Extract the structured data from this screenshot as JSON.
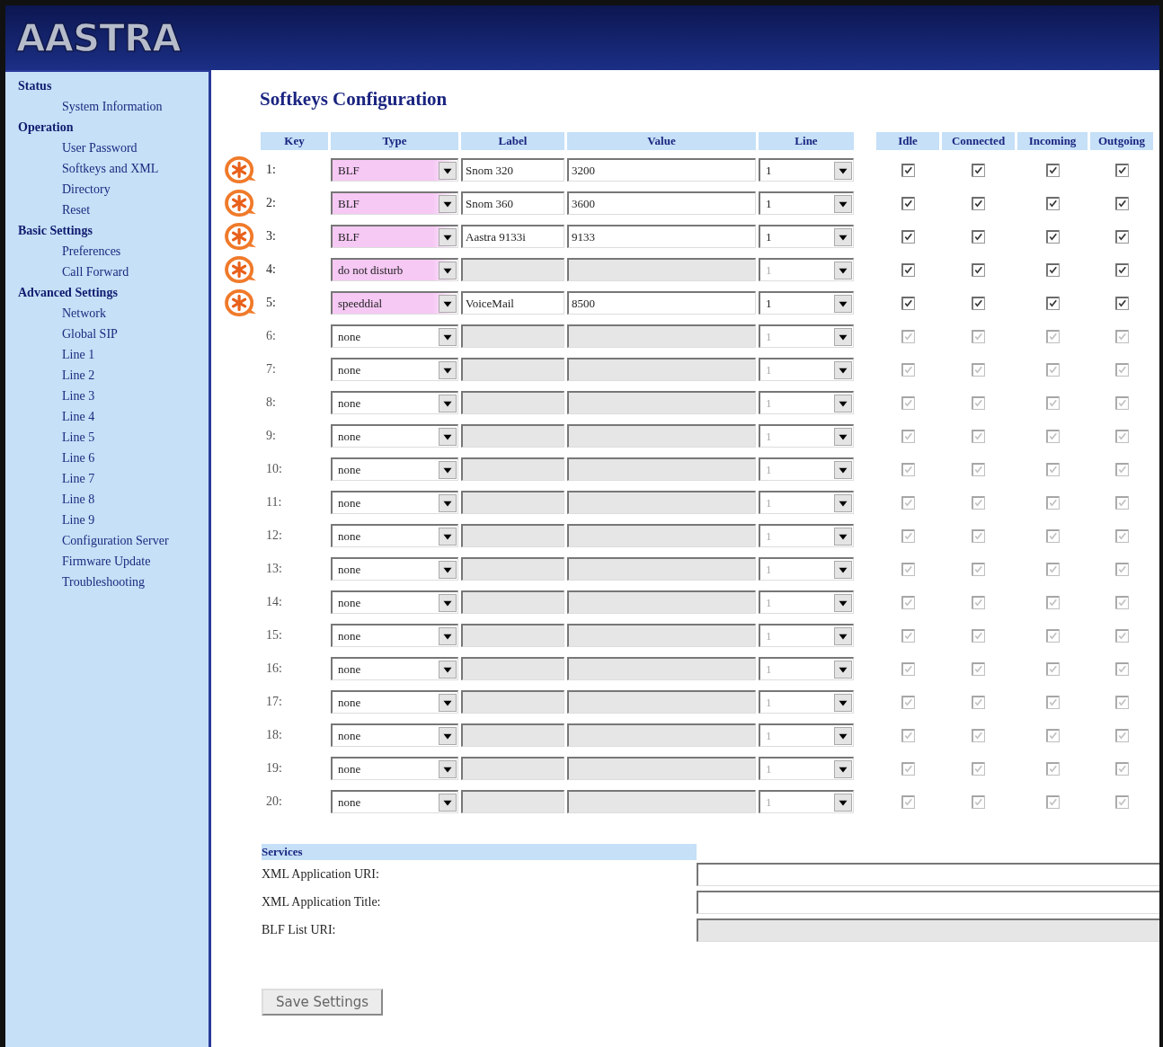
{
  "header": {
    "logo": "AASTRA"
  },
  "sidebar": {
    "groups": [
      {
        "title": "Status",
        "items": [
          "System Information"
        ]
      },
      {
        "title": "Operation",
        "items": [
          "User Password",
          "Softkeys and XML",
          "Directory",
          "Reset"
        ]
      },
      {
        "title": "Basic Settings",
        "items": [
          "Preferences",
          "Call Forward"
        ]
      },
      {
        "title": "Advanced Settings",
        "items": [
          "Network",
          "Global SIP",
          "Line 1",
          "Line 2",
          "Line 3",
          "Line 4",
          "Line 5",
          "Line 6",
          "Line 7",
          "Line 8",
          "Line 9",
          "Configuration Server",
          "Firmware Update",
          "Troubleshooting"
        ]
      }
    ]
  },
  "page_title": "Softkeys Configuration",
  "table": {
    "columns": [
      "Key",
      "Type",
      "Label",
      "Value",
      "Line",
      "Idle",
      "Connected",
      "Incoming",
      "Outgoing"
    ],
    "rows": [
      {
        "key": "1:",
        "type": "BLF",
        "label": "Snom 320",
        "value": "3200",
        "line": "1",
        "highlighted": true,
        "disabled": false,
        "line_disabled": false,
        "idle": true,
        "connected": true,
        "incoming": true,
        "outgoing": true
      },
      {
        "key": "2:",
        "type": "BLF",
        "label": "Snom 360",
        "value": "3600",
        "line": "1",
        "highlighted": true,
        "disabled": false,
        "line_disabled": false,
        "idle": true,
        "connected": true,
        "incoming": true,
        "outgoing": true
      },
      {
        "key": "3:",
        "type": "BLF",
        "label": "Aastra 9133i",
        "value": "9133",
        "line": "1",
        "highlighted": true,
        "disabled": false,
        "line_disabled": false,
        "idle": true,
        "connected": true,
        "incoming": true,
        "outgoing": true
      },
      {
        "key": "4:",
        "type": "do not disturb",
        "label": "",
        "value": "",
        "line": "1",
        "highlighted": true,
        "disabled": true,
        "line_disabled": true,
        "idle": true,
        "connected": true,
        "incoming": true,
        "outgoing": true
      },
      {
        "key": "5:",
        "type": "speeddial",
        "label": "VoiceMail",
        "value": "8500",
        "line": "1",
        "highlighted": true,
        "disabled": false,
        "line_disabled": false,
        "idle": true,
        "connected": true,
        "incoming": true,
        "outgoing": true
      },
      {
        "key": "6:",
        "type": "none",
        "label": "",
        "value": "",
        "line": "1",
        "highlighted": false,
        "disabled": true,
        "line_disabled": true,
        "idle": true,
        "connected": true,
        "incoming": true,
        "outgoing": true
      },
      {
        "key": "7:",
        "type": "none",
        "label": "",
        "value": "",
        "line": "1",
        "highlighted": false,
        "disabled": true,
        "line_disabled": true,
        "idle": true,
        "connected": true,
        "incoming": true,
        "outgoing": true
      },
      {
        "key": "8:",
        "type": "none",
        "label": "",
        "value": "",
        "line": "1",
        "highlighted": false,
        "disabled": true,
        "line_disabled": true,
        "idle": true,
        "connected": true,
        "incoming": true,
        "outgoing": true
      },
      {
        "key": "9:",
        "type": "none",
        "label": "",
        "value": "",
        "line": "1",
        "highlighted": false,
        "disabled": true,
        "line_disabled": true,
        "idle": true,
        "connected": true,
        "incoming": true,
        "outgoing": true
      },
      {
        "key": "10:",
        "type": "none",
        "label": "",
        "value": "",
        "line": "1",
        "highlighted": false,
        "disabled": true,
        "line_disabled": true,
        "idle": true,
        "connected": true,
        "incoming": true,
        "outgoing": true
      },
      {
        "key": "11:",
        "type": "none",
        "label": "",
        "value": "",
        "line": "1",
        "highlighted": false,
        "disabled": true,
        "line_disabled": true,
        "idle": true,
        "connected": true,
        "incoming": true,
        "outgoing": true
      },
      {
        "key": "12:",
        "type": "none",
        "label": "",
        "value": "",
        "line": "1",
        "highlighted": false,
        "disabled": true,
        "line_disabled": true,
        "idle": true,
        "connected": true,
        "incoming": true,
        "outgoing": true
      },
      {
        "key": "13:",
        "type": "none",
        "label": "",
        "value": "",
        "line": "1",
        "highlighted": false,
        "disabled": true,
        "line_disabled": true,
        "idle": true,
        "connected": true,
        "incoming": true,
        "outgoing": true
      },
      {
        "key": "14:",
        "type": "none",
        "label": "",
        "value": "",
        "line": "1",
        "highlighted": false,
        "disabled": true,
        "line_disabled": true,
        "idle": true,
        "connected": true,
        "incoming": true,
        "outgoing": true
      },
      {
        "key": "15:",
        "type": "none",
        "label": "",
        "value": "",
        "line": "1",
        "highlighted": false,
        "disabled": true,
        "line_disabled": true,
        "idle": true,
        "connected": true,
        "incoming": true,
        "outgoing": true
      },
      {
        "key": "16:",
        "type": "none",
        "label": "",
        "value": "",
        "line": "1",
        "highlighted": false,
        "disabled": true,
        "line_disabled": true,
        "idle": true,
        "connected": true,
        "incoming": true,
        "outgoing": true
      },
      {
        "key": "17:",
        "type": "none",
        "label": "",
        "value": "",
        "line": "1",
        "highlighted": false,
        "disabled": true,
        "line_disabled": true,
        "idle": true,
        "connected": true,
        "incoming": true,
        "outgoing": true
      },
      {
        "key": "18:",
        "type": "none",
        "label": "",
        "value": "",
        "line": "1",
        "highlighted": false,
        "disabled": true,
        "line_disabled": true,
        "idle": true,
        "connected": true,
        "incoming": true,
        "outgoing": true
      },
      {
        "key": "19:",
        "type": "none",
        "label": "",
        "value": "",
        "line": "1",
        "highlighted": false,
        "disabled": true,
        "line_disabled": true,
        "idle": true,
        "connected": true,
        "incoming": true,
        "outgoing": true
      },
      {
        "key": "20:",
        "type": "none",
        "label": "",
        "value": "",
        "line": "1",
        "highlighted": false,
        "disabled": true,
        "line_disabled": true,
        "idle": true,
        "connected": true,
        "incoming": true,
        "outgoing": true
      }
    ]
  },
  "services": {
    "title": "Services",
    "fields": [
      {
        "label": "XML Application URI:",
        "disabled": false
      },
      {
        "label": "XML Application Title:",
        "disabled": false
      },
      {
        "label": "BLF List URI:",
        "disabled": true
      }
    ]
  },
  "save_button": "Save Settings"
}
